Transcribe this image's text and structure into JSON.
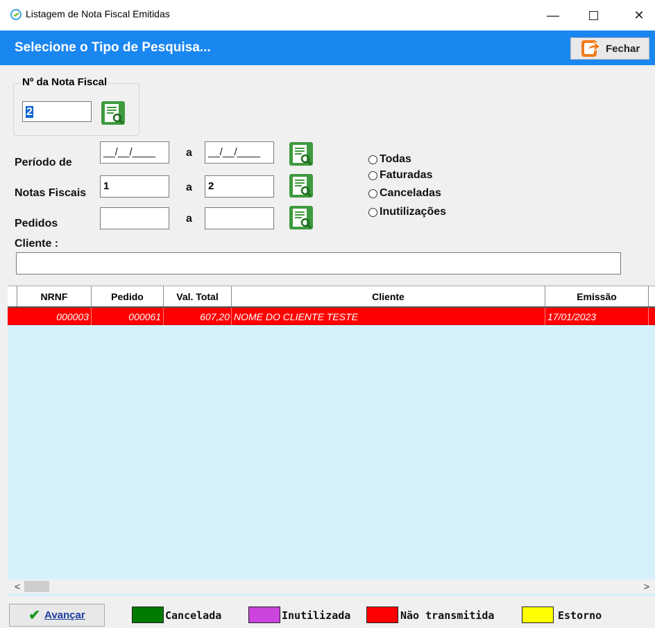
{
  "window": {
    "title": "Listagem de Nota Fiscal Emitidas"
  },
  "header": {
    "title": "Selecione o Tipo de Pesquisa...",
    "close_label": "Fechar"
  },
  "nota_fiscal": {
    "legend": "Nº da Nota Fiscal",
    "value": "2"
  },
  "filters": {
    "periodo_label": "Período de",
    "periodo_from": "__/__/____",
    "periodo_to": "__/__/____",
    "notas_label": "Notas Fiscais",
    "notas_from": "1",
    "notas_to": "2",
    "pedidos_label": "Pedidos",
    "pedidos_from": "",
    "pedidos_to": "",
    "a_label": "a",
    "cliente_label": "Cliente :",
    "cliente_value": ""
  },
  "radios": [
    "Todas",
    "Faturadas",
    "Canceladas",
    "Inutilizações"
  ],
  "grid": {
    "columns": [
      "NRNF",
      "Pedido",
      "Val. Total",
      "Cliente",
      "Emissão"
    ],
    "rows": [
      {
        "nrnf": "000003",
        "pedido": "000061",
        "val_total": "607,20",
        "cliente": "NOME DO CLIENTE TESTE",
        "emissao": "17/01/2023",
        "status_color": "#ff0000"
      }
    ]
  },
  "footer": {
    "advance_label": "Avançar",
    "legend": [
      {
        "label": "Cancelada",
        "color": "#007a00"
      },
      {
        "label": "Inutilizada",
        "color": "#cc44dd"
      },
      {
        "label": "Não transmitida",
        "color": "#ff0000"
      },
      {
        "label": "Estorno",
        "color": "#ffff00"
      }
    ]
  }
}
